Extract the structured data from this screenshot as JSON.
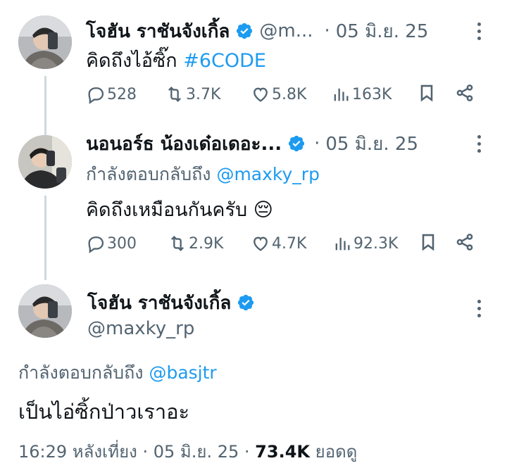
{
  "tweet1": {
    "name": "โจฮัน ราชันจังเกิ้ล",
    "handle": "@m...",
    "separator": "·",
    "date": "05 มิ.ย. 25",
    "text": "คิดถึงไอ้ซิ๊ก",
    "hashtag": "#6CODE",
    "stats": {
      "replies": "528",
      "retweets": "3.7K",
      "likes": "5.8K",
      "views": "163K"
    }
  },
  "tweet2": {
    "name": "นอนอร์ธ น้องเด๋อเดอะ...",
    "separator": "·",
    "date": "05 มิ.ย. 25",
    "replying_prefix": "กำลังตอบกลับถึง",
    "replying_handle": "@maxky_rp",
    "text": "คิดถึงเหมือนกันครับ",
    "emoji": "😔",
    "stats": {
      "replies": "300",
      "retweets": "2.9K",
      "likes": "4.7K",
      "views": "92.3K"
    }
  },
  "main": {
    "name": "โจฮัน ราชันจังเกิ้ล",
    "handle": "@maxky_rp",
    "replying_prefix": "กำลังตอบกลับถึง",
    "replying_handle": "@basjtr",
    "text": "เป็นไอ่ซิ้กป่าวเราอะ",
    "time": "16:29 หลังเที่ยง",
    "separator": "·",
    "date": "05 มิ.ย. 25",
    "separator2": "·",
    "views": "73.4K",
    "views_label": "ยอดดู"
  },
  "colors": {
    "accent": "#1d9bf0",
    "muted": "#536471",
    "text": "#0f1419",
    "line": "#cfd9de"
  },
  "icons": [
    "verified-badge",
    "more-dots",
    "reply-icon",
    "retweet-icon",
    "like-icon",
    "views-icon",
    "bookmark-icon",
    "share-icon"
  ]
}
